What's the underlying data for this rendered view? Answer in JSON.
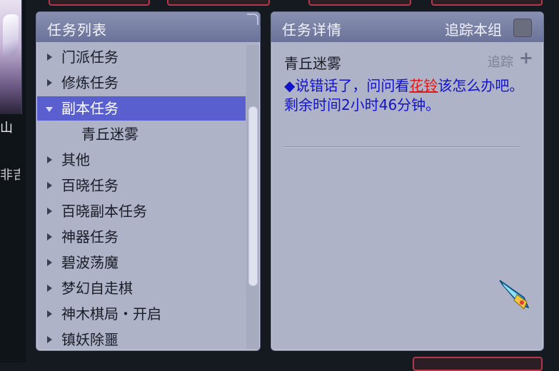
{
  "left_strip": {
    "text_1": "山",
    "text_2": "非吉"
  },
  "quest_list": {
    "title": "任务列表",
    "items": [
      {
        "label": "门派任务",
        "type": "collapsed"
      },
      {
        "label": "修炼任务",
        "type": "collapsed"
      },
      {
        "label": "副本任务",
        "type": "expanded",
        "selected": true
      },
      {
        "label": "青丘迷雾",
        "type": "child"
      },
      {
        "label": "其他",
        "type": "collapsed"
      },
      {
        "label": "百晓任务",
        "type": "collapsed"
      },
      {
        "label": "百晓副本任务",
        "type": "collapsed"
      },
      {
        "label": "神器任务",
        "type": "collapsed"
      },
      {
        "label": "碧波荡魔",
        "type": "collapsed"
      },
      {
        "label": "梦幻自走棋",
        "type": "collapsed"
      },
      {
        "label": "神木棋局・开启",
        "type": "collapsed"
      },
      {
        "label": "镇妖除噩",
        "type": "collapsed"
      }
    ]
  },
  "quest_detail": {
    "title": "任务详情",
    "track_group_label": "追踪本组",
    "quest_name": "青丘迷雾",
    "track_label": "追踪",
    "track_plus": "+",
    "desc_prefix": "◆说错话了，问问看",
    "npc_name": "花铃",
    "desc_suffix": "该怎么办吧。剩余时间2小时46分钟。"
  },
  "colors": {
    "panel_bg": "#aeb3c8",
    "header_bg": "#7880a6",
    "selected_bg": "#5a5fd0",
    "desc_text": "#1212cc",
    "npc_link": "#dd1a1a"
  },
  "icons": {
    "corner_item": "sword-icon"
  }
}
